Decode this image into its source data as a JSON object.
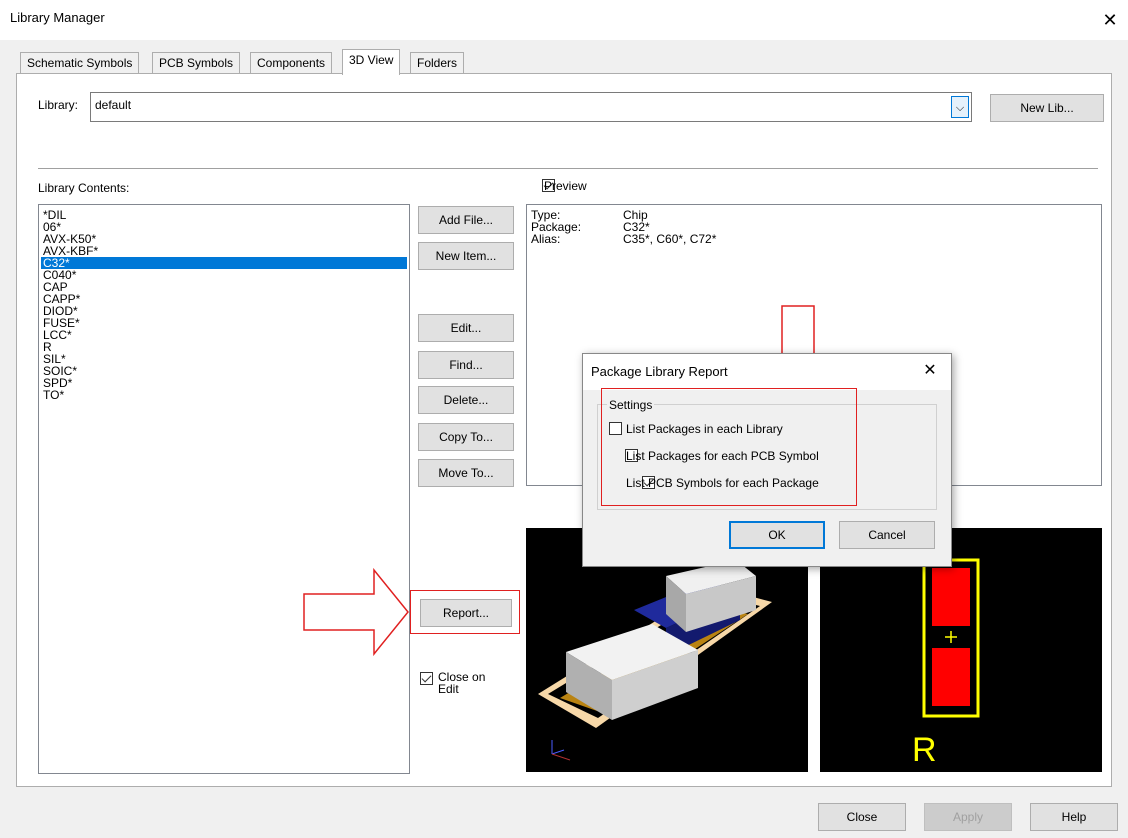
{
  "window": {
    "title": "Library Manager",
    "close_glyph": "✕"
  },
  "tabs": [
    {
      "label": "Schematic Symbols",
      "active": false
    },
    {
      "label": "PCB Symbols",
      "active": false
    },
    {
      "label": "Components",
      "active": false
    },
    {
      "label": "3D View",
      "active": true
    },
    {
      "label": "Folders",
      "active": false
    }
  ],
  "library": {
    "label": "Library:",
    "value": "default",
    "new_lib_button": "New Lib..."
  },
  "contents": {
    "label": "Library Contents:",
    "items": [
      "*DIL",
      "06*",
      "AVX-K50*",
      "AVX-KBF*",
      "C32*",
      "C040*",
      "CAP",
      "CAPP*",
      "DIOD*",
      "FUSE*",
      "LCC*",
      "R",
      "SIL*",
      "SOIC*",
      "SPD*",
      "TO*"
    ],
    "selected": "C32*"
  },
  "buttons": {
    "add_file": "Add File...",
    "new_item": "New Item...",
    "edit": "Edit...",
    "find": "Find...",
    "delete": "Delete...",
    "copy_to": "Copy To...",
    "move_to": "Move To...",
    "report": "Report..."
  },
  "close_on_edit": {
    "label": "Close on\nEdit",
    "checked": true
  },
  "preview": {
    "label": "Preview",
    "checked": true,
    "type_label": "Type:",
    "type_value": "Chip",
    "package_label": "Package:",
    "package_value": "C32*",
    "alias_label": "Alias:",
    "alias_value": "C35*, C60*, C72*",
    "pcb_ref_label": "R"
  },
  "footer": {
    "close": "Close",
    "apply": "Apply",
    "help": "Help"
  },
  "dialog": {
    "title": "Package Library Report",
    "close_glyph": "✕",
    "group_label": "Settings",
    "options": [
      {
        "label": "List Packages in each Library",
        "checked": false
      },
      {
        "label": "List Packages for each PCB Symbol",
        "checked": false
      },
      {
        "label": "List PCB Symbols for each Package",
        "checked": true
      }
    ],
    "ok": "OK",
    "cancel": "Cancel"
  },
  "colors": {
    "selection": "#0078d7",
    "annotation": "#e02020",
    "pad": "#ff0000",
    "silkscreen": "#ffff00",
    "board": "#c08a1a"
  }
}
